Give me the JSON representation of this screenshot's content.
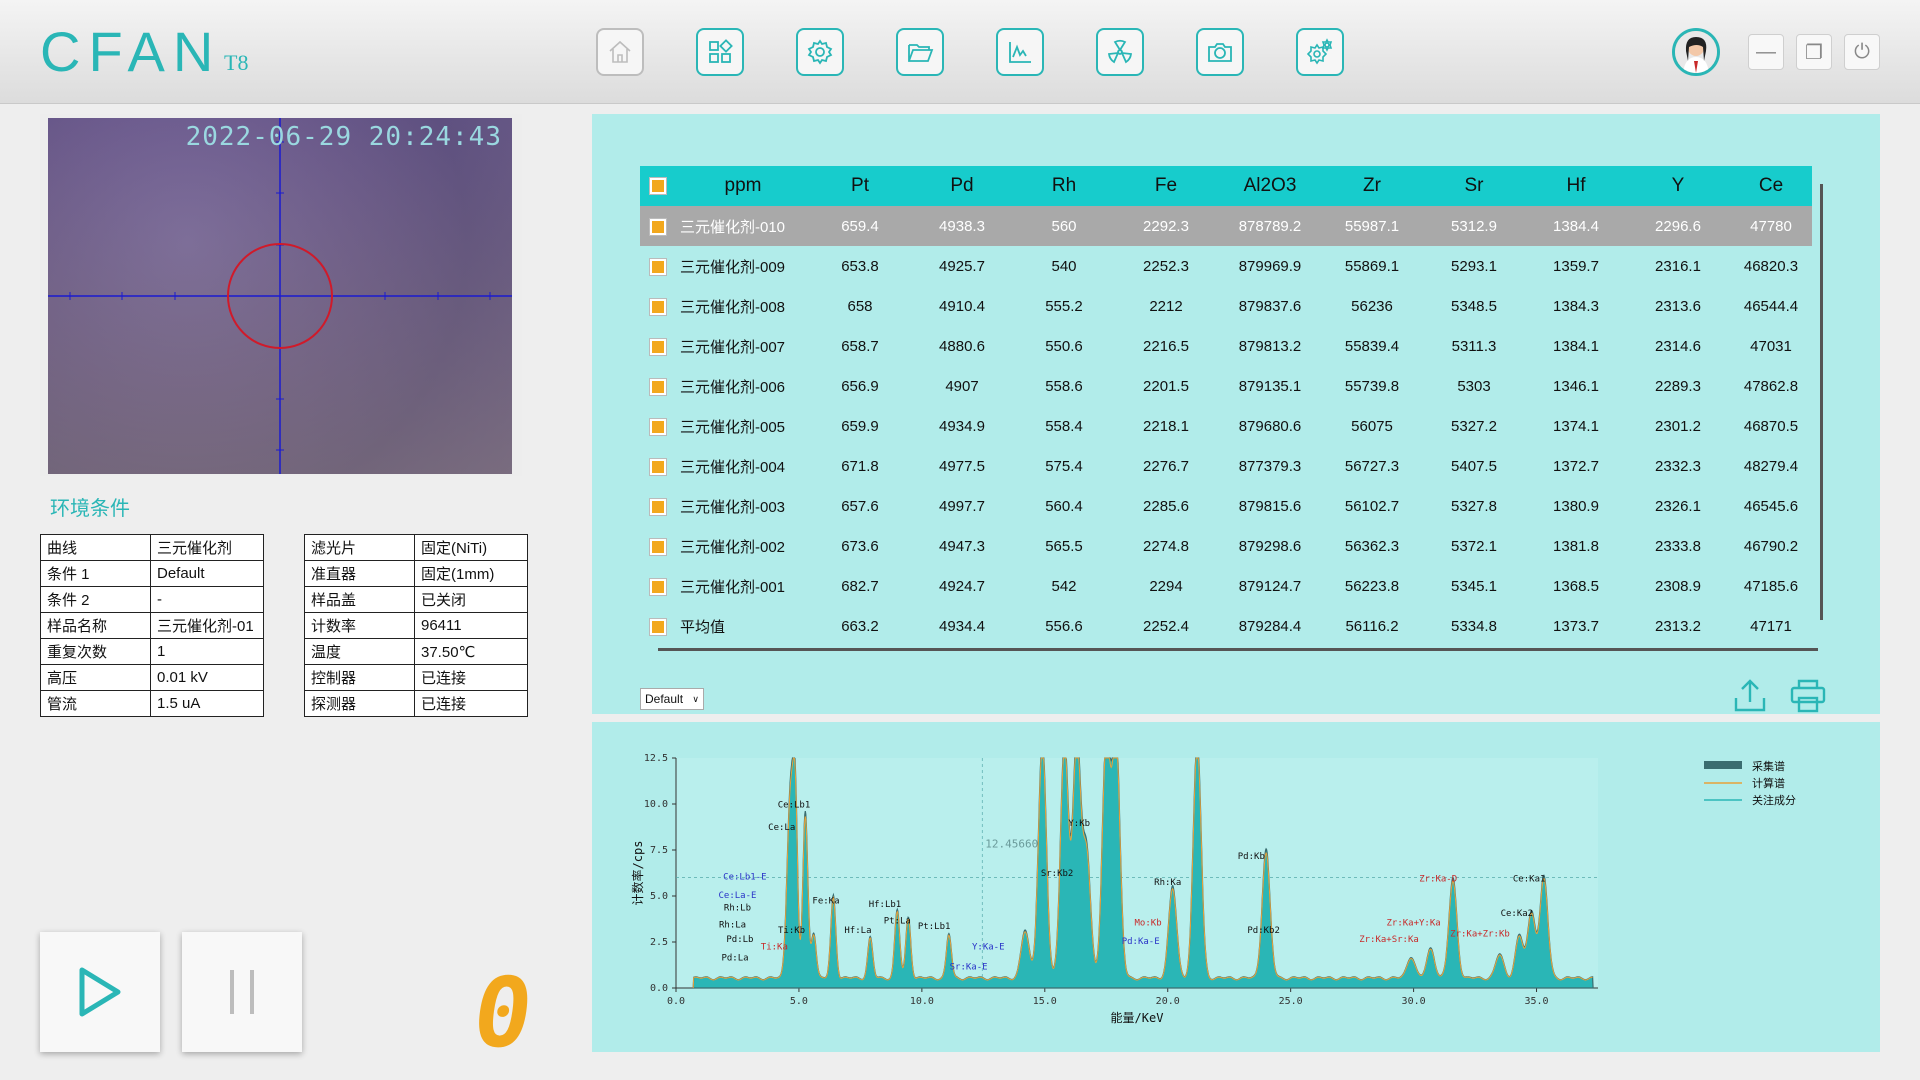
{
  "header": {
    "logo_text": "CFAN",
    "model": "T8",
    "tools": [
      "home-icon",
      "apps-icon",
      "settings-icon",
      "folder-icon",
      "spectrum-icon",
      "radiation-icon",
      "camera-icon",
      "advanced-settings-icon"
    ],
    "window_buttons": [
      "—",
      "❐",
      "⏻"
    ]
  },
  "camera": {
    "timestamp": "2022-06-29 20:24:43"
  },
  "environment": {
    "title": "环境条件",
    "left": [
      {
        "k": "曲线",
        "v": "三元催化剂"
      },
      {
        "k": "条件 1",
        "v": "Default"
      },
      {
        "k": "条件 2",
        "v": "-"
      },
      {
        "k": "样品名称",
        "v": "三元催化剂-01"
      },
      {
        "k": "重复次数",
        "v": "1"
      },
      {
        "k": "高压",
        "v": "0.01 kV"
      },
      {
        "k": "管流",
        "v": "1.5 uA"
      }
    ],
    "right": [
      {
        "k": "滤光片",
        "v": "固定(NiTi)"
      },
      {
        "k": "准直器",
        "v": "固定(1mm)"
      },
      {
        "k": "样品盖",
        "v": "已关闭"
      },
      {
        "k": "计数率",
        "v": "96411"
      },
      {
        "k": "温度",
        "v": "37.50℃"
      },
      {
        "k": "控制器",
        "v": "已连接"
      },
      {
        "k": "探测器",
        "v": "已连接"
      }
    ]
  },
  "counter": "0",
  "results": {
    "headers": [
      "ppm",
      "Pt",
      "Pd",
      "Rh",
      "Fe",
      "Al2O3",
      "Zr",
      "Sr",
      "Hf",
      "Y",
      "Ce"
    ],
    "rows": [
      [
        "三元催化剂-010",
        "659.4",
        "4938.3",
        "560",
        "2292.3",
        "878789.2",
        "55987.1",
        "5312.9",
        "1384.4",
        "2296.6",
        "47780"
      ],
      [
        "三元催化剂-009",
        "653.8",
        "4925.7",
        "540",
        "2252.3",
        "879969.9",
        "55869.1",
        "5293.1",
        "1359.7",
        "2316.1",
        "46820.3"
      ],
      [
        "三元催化剂-008",
        "658",
        "4910.4",
        "555.2",
        "2212",
        "879837.6",
        "56236",
        "5348.5",
        "1384.3",
        "2313.6",
        "46544.4"
      ],
      [
        "三元催化剂-007",
        "658.7",
        "4880.6",
        "550.6",
        "2216.5",
        "879813.2",
        "55839.4",
        "5311.3",
        "1384.1",
        "2314.6",
        "47031"
      ],
      [
        "三元催化剂-006",
        "656.9",
        "4907",
        "558.6",
        "2201.5",
        "879135.1",
        "55739.8",
        "5303",
        "1346.1",
        "2289.3",
        "47862.8"
      ],
      [
        "三元催化剂-005",
        "659.9",
        "4934.9",
        "558.4",
        "2218.1",
        "879680.6",
        "56075",
        "5327.2",
        "1374.1",
        "2301.2",
        "46870.5"
      ],
      [
        "三元催化剂-004",
        "671.8",
        "4977.5",
        "575.4",
        "2276.7",
        "877379.3",
        "56727.3",
        "5407.5",
        "1372.7",
        "2332.3",
        "48279.4"
      ],
      [
        "三元催化剂-003",
        "657.6",
        "4997.7",
        "560.4",
        "2285.6",
        "879815.6",
        "56102.7",
        "5327.8",
        "1380.9",
        "2326.1",
        "46545.6"
      ],
      [
        "三元催化剂-002",
        "673.6",
        "4947.3",
        "565.5",
        "2274.8",
        "879298.6",
        "56362.3",
        "5372.1",
        "1381.8",
        "2333.8",
        "46790.2"
      ],
      [
        "三元催化剂-001",
        "682.7",
        "4924.7",
        "542",
        "2294",
        "879124.7",
        "56223.8",
        "5345.1",
        "1368.5",
        "2308.9",
        "47185.6"
      ],
      [
        "平均值",
        "663.2",
        "4934.4",
        "556.6",
        "2252.4",
        "879284.4",
        "56116.2",
        "5334.8",
        "1373.7",
        "2313.2",
        "47171"
      ]
    ],
    "condition_select": "Default"
  },
  "chart_data": {
    "type": "area",
    "xlabel": "能量/KeV",
    "ylabel": "计数率/cps",
    "xlim": [
      0,
      37.5
    ],
    "ylim": [
      0,
      12.5
    ],
    "xticks": [
      "0.0",
      "5.0",
      "10.0",
      "15.0",
      "20.0",
      "25.0",
      "30.0",
      "35.0"
    ],
    "yticks": [
      "0.0",
      "2.5",
      "5.0",
      "7.5",
      "10.0",
      "12.5"
    ],
    "cursor_readout": "12.456608",
    "legend": [
      {
        "name": "采集谱",
        "color": "#3a6d70"
      },
      {
        "name": "计算谱",
        "color": "#e8a23a"
      },
      {
        "name": "关注成分",
        "color": "#2ab6b6"
      }
    ],
    "peaks": [
      {
        "e": 4.84,
        "h": 10.5
      },
      {
        "e": 4.65,
        "h": 8.2
      },
      {
        "e": 5.26,
        "h": 9.0
      },
      {
        "e": 4.51,
        "h": 2.6
      },
      {
        "e": 5.6,
        "h": 2.5
      },
      {
        "e": 6.4,
        "h": 4.5
      },
      {
        "e": 7.9,
        "h": 2.2
      },
      {
        "e": 9.0,
        "h": 3.7
      },
      {
        "e": 9.45,
        "h": 3.3
      },
      {
        "e": 11.1,
        "h": 2.4
      },
      {
        "e": 14.2,
        "h": 2.6
      },
      {
        "e": 14.9,
        "h": 13
      },
      {
        "e": 15.8,
        "h": 13
      },
      {
        "e": 16.3,
        "h": 13
      },
      {
        "e": 16.7,
        "h": 7.0
      },
      {
        "e": 17.5,
        "h": 13
      },
      {
        "e": 17.9,
        "h": 13
      },
      {
        "e": 20.2,
        "h": 5.0
      },
      {
        "e": 21.2,
        "h": 13
      },
      {
        "e": 24.0,
        "h": 7.0
      },
      {
        "e": 29.9,
        "h": 1.2
      },
      {
        "e": 30.7,
        "h": 1.6
      },
      {
        "e": 31.6,
        "h": 5.4
      },
      {
        "e": 33.5,
        "h": 1.3
      },
      {
        "e": 34.3,
        "h": 2.3
      },
      {
        "e": 34.8,
        "h": 3.6
      },
      {
        "e": 35.3,
        "h": 5.5
      }
    ],
    "annotations": [
      {
        "text": "Ce:Lb1",
        "e": 4.8,
        "y": 9.8,
        "color": "#111"
      },
      {
        "text": "Ce:La",
        "e": 4.3,
        "y": 8.6,
        "color": "#111"
      },
      {
        "text": "Ce:Lb1-E",
        "e": 2.8,
        "y": 5.9,
        "color": "#2a34c8"
      },
      {
        "text": "Ce:La-E",
        "e": 2.5,
        "y": 4.9,
        "color": "#2a34c8"
      },
      {
        "text": "Rh:Lb",
        "e": 2.5,
        "y": 4.2,
        "color": "#111"
      },
      {
        "text": "Rh:La",
        "e": 2.3,
        "y": 3.3,
        "color": "#111"
      },
      {
        "text": "Pd:Lb",
        "e": 2.6,
        "y": 2.5,
        "color": "#111"
      },
      {
        "text": "Pd:La",
        "e": 2.4,
        "y": 1.5,
        "color": "#111"
      },
      {
        "text": "Ti:Kb",
        "e": 4.7,
        "y": 3.0,
        "color": "#111"
      },
      {
        "text": "Ti:Ka",
        "e": 4.0,
        "y": 2.1,
        "color": "#c82a2a"
      },
      {
        "text": "Fe:Ka",
        "e": 6.1,
        "y": 4.6,
        "color": "#111"
      },
      {
        "text": "Hf:La",
        "e": 7.4,
        "y": 3.0,
        "color": "#111"
      },
      {
        "text": "Hf:Lb1",
        "e": 8.5,
        "y": 4.4,
        "color": "#111"
      },
      {
        "text": "Pt:La",
        "e": 9.0,
        "y": 3.5,
        "color": "#111"
      },
      {
        "text": "Pt:Lb1",
        "e": 10.5,
        "y": 3.2,
        "color": "#111"
      },
      {
        "text": "Y:Ka-E",
        "e": 12.7,
        "y": 2.1,
        "color": "#2a34c8"
      },
      {
        "text": "Sr:Ka-E",
        "e": 11.9,
        "y": 1.0,
        "color": "#2a34c8"
      },
      {
        "text": "Sr:Kb2",
        "e": 15.5,
        "y": 6.1,
        "color": "#111"
      },
      {
        "text": "Y:Kb",
        "e": 16.4,
        "y": 8.8,
        "color": "#111"
      },
      {
        "text": "Rh:Ka",
        "e": 20.0,
        "y": 5.6,
        "color": "#111"
      },
      {
        "text": "Mo:Kb",
        "e": 19.2,
        "y": 3.4,
        "color": "#c82a2a"
      },
      {
        "text": "Pd:Ka-E",
        "e": 18.9,
        "y": 2.4,
        "color": "#2a34c8"
      },
      {
        "text": "Pd:Kb",
        "e": 23.4,
        "y": 7.0,
        "color": "#111"
      },
      {
        "text": "Pd:Kb2",
        "e": 23.9,
        "y": 3.0,
        "color": "#111"
      },
      {
        "text": "Zr:Ka-D",
        "e": 31.0,
        "y": 5.8,
        "color": "#c82a2a"
      },
      {
        "text": "Zr:Ka+Y:Ka",
        "e": 30.0,
        "y": 3.4,
        "color": "#c82a2a"
      },
      {
        "text": "Zr:Ka+Sr:Ka",
        "e": 29.0,
        "y": 2.5,
        "color": "#c82a2a"
      },
      {
        "text": "Zr:Ka+Zr:Kb",
        "e": 32.7,
        "y": 2.8,
        "color": "#c82a2a"
      },
      {
        "text": "Ce:Ka1",
        "e": 34.7,
        "y": 5.8,
        "color": "#111"
      },
      {
        "text": "Ce:Ka2",
        "e": 34.2,
        "y": 3.9,
        "color": "#111"
      }
    ]
  }
}
